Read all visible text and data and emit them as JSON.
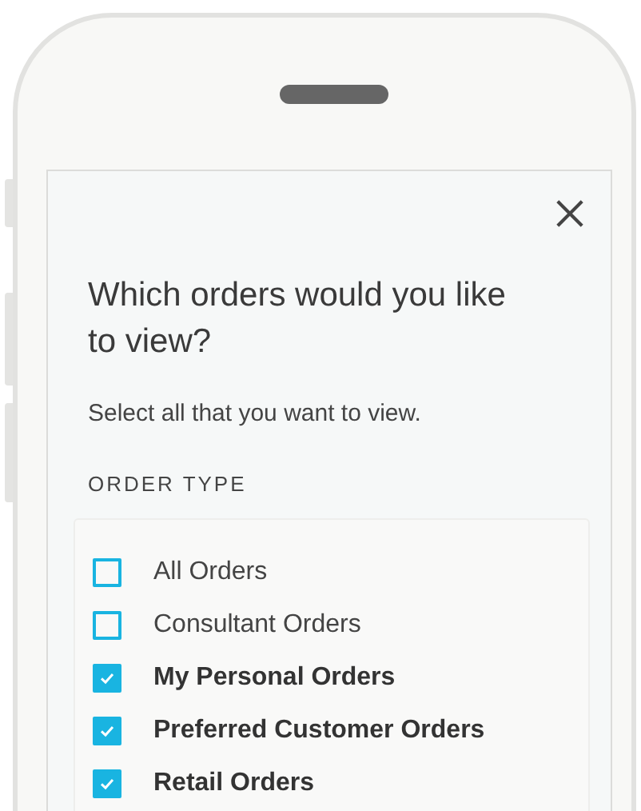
{
  "dialog": {
    "title": "Which orders would you like to view?",
    "subtitle": "Select all that you want to view.",
    "section_label": "ORDER TYPE",
    "options": [
      {
        "label": "All Orders",
        "checked": false
      },
      {
        "label": "Consultant Orders",
        "checked": false
      },
      {
        "label": "My Personal Orders",
        "checked": true
      },
      {
        "label": "Preferred Customer Orders",
        "checked": true
      },
      {
        "label": "Retail Orders",
        "checked": true
      }
    ]
  }
}
